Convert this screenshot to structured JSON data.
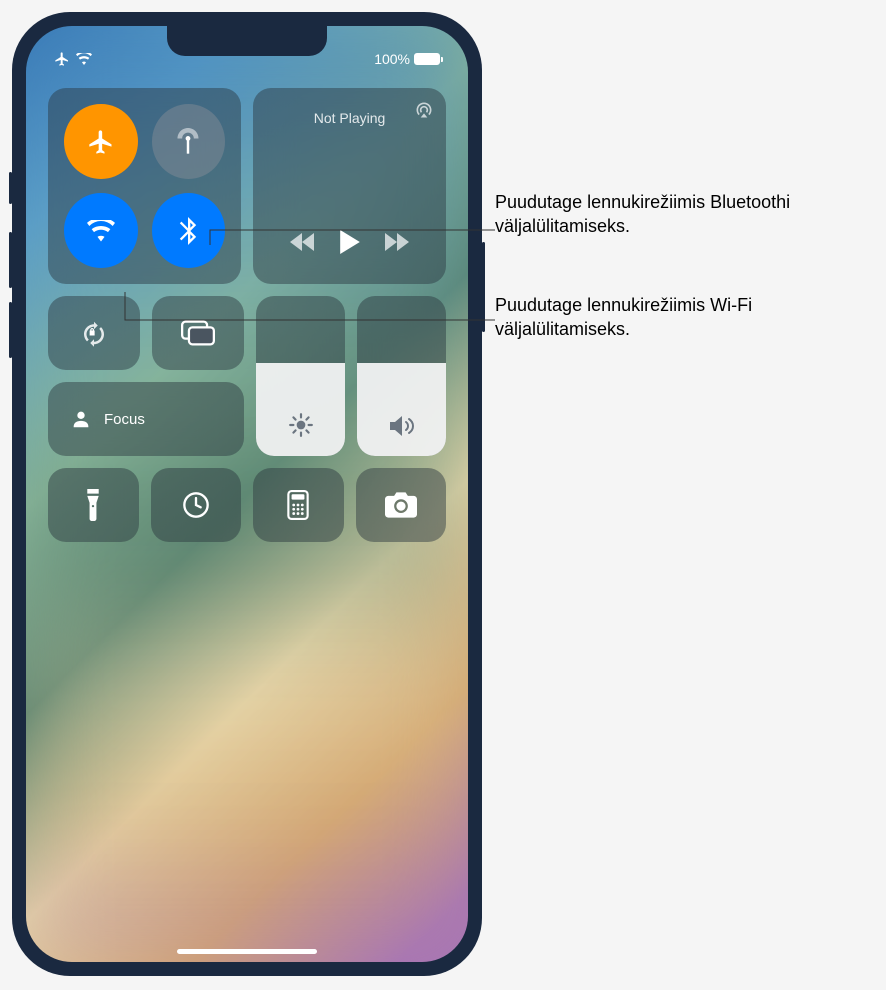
{
  "status": {
    "battery": "100%"
  },
  "media": {
    "title": "Not Playing"
  },
  "focus": {
    "label": "Focus"
  },
  "sliders": {
    "brightness_pct": 58,
    "volume_pct": 58
  },
  "icons": {
    "airplane": "airplane-icon",
    "cellular": "cellular-antenna-icon",
    "wifi": "wifi-icon",
    "bluetooth": "bluetooth-icon",
    "airplay": "airplay-icon",
    "prev": "prev-track-icon",
    "play": "play-icon",
    "next": "next-track-icon",
    "lock": "rotation-lock-icon",
    "mirror": "screen-mirroring-icon",
    "focus": "focus-person-icon",
    "brightness": "sun-icon",
    "volume": "speaker-icon",
    "flashlight": "flashlight-icon",
    "timer": "timer-icon",
    "calculator": "calculator-icon",
    "camera": "camera-icon"
  },
  "callouts": [
    {
      "text": "Puudutage lennukirežiimis Bluetoothi väljalülitamiseks."
    },
    {
      "text": "Puudutage lennukirežiimis Wi-Fi väljalülitamiseks."
    }
  ],
  "colors": {
    "orange": "#ff9500",
    "blue": "#007aff",
    "tile": "rgba(40,50,60,0.45)"
  }
}
